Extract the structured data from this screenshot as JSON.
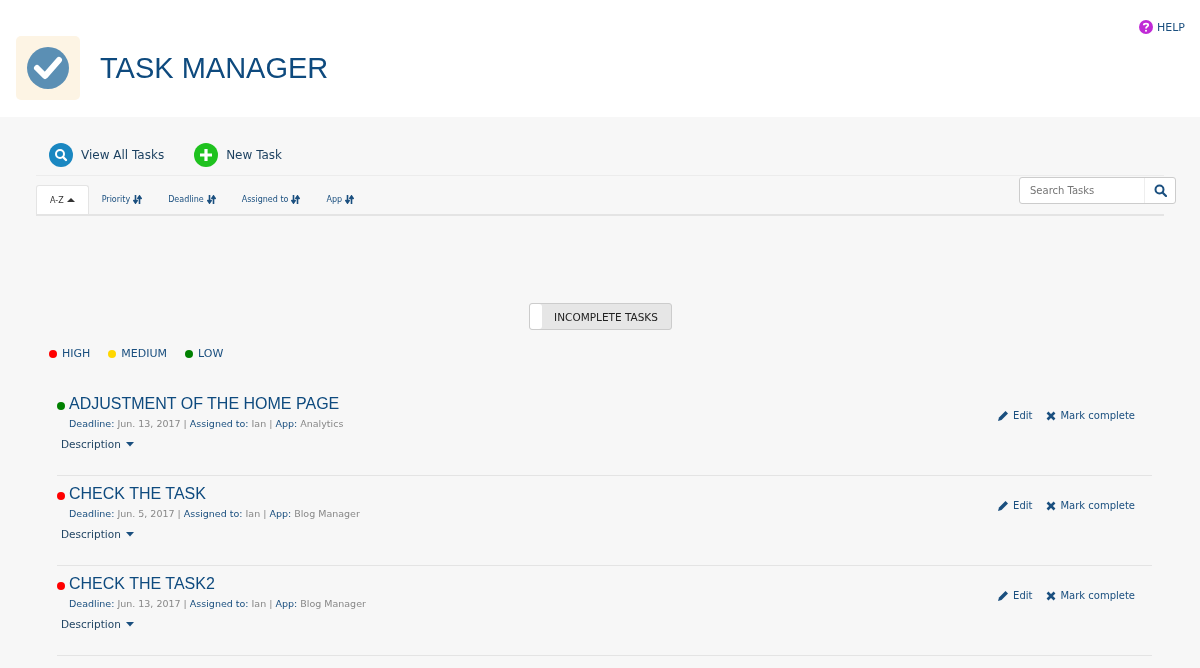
{
  "header": {
    "title": "TASK MANAGER",
    "help": "HELP"
  },
  "actions": [
    {
      "kind": "view",
      "label": "View All Tasks"
    },
    {
      "kind": "new",
      "label": "New Task"
    }
  ],
  "sort_tabs": [
    {
      "label": "A-Z",
      "selected": true
    },
    {
      "label": "Priority",
      "selected": false
    },
    {
      "label": "Deadline",
      "selected": false
    },
    {
      "label": "Assigned to",
      "selected": false
    },
    {
      "label": "App",
      "selected": false
    }
  ],
  "search": {
    "placeholder": "Search Tasks"
  },
  "filter_toggle": {
    "label": "INCOMPLETE TASKS",
    "on": false
  },
  "legend": [
    {
      "label": "HIGH",
      "color": "#ff0000"
    },
    {
      "label": "MEDIUM",
      "color": "#ffd700"
    },
    {
      "label": "LOW",
      "color": "#008000"
    }
  ],
  "tasks": [
    {
      "title": "ADJUSTMENT OF THE HOME PAGE",
      "color": "#008000",
      "meta": "**Deadline:** Jun. 13, 2017 | **Assigned to:** Ian | **App:** Analytics",
      "description": "Description",
      "edit": "Edit",
      "complete": "Mark complete"
    },
    {
      "title": "CHECK THE TASK",
      "color": "#ff0000",
      "meta": "**Deadline:** Jun. 5, 2017 | **Assigned to:** Ian | **App:** Blog Manager",
      "description": "Description",
      "edit": "Edit",
      "complete": "Mark complete"
    },
    {
      "title": "CHECK THE TASK2",
      "color": "#ff0000",
      "meta": "**Deadline:** Jun. 13, 2017 | **Assigned to:** Ian | **App:** Blog Manager",
      "description": "Description",
      "edit": "Edit",
      "complete": "Mark complete"
    }
  ]
}
